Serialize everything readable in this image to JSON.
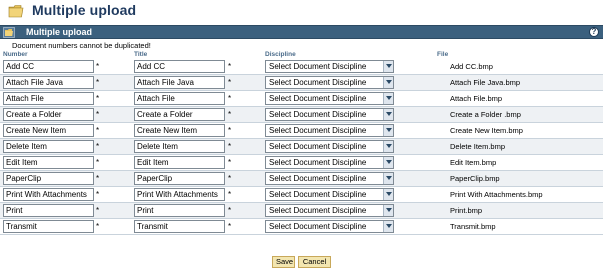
{
  "header": {
    "title": "Multiple upload"
  },
  "panel": {
    "title": "Multiple upload",
    "help_symbol": "?"
  },
  "notice": "Document numbers cannot be duplicated!",
  "columns": {
    "number": "Number",
    "title": "Title",
    "discipline": "Discipline",
    "file": "File"
  },
  "rows": [
    {
      "number": "Add CC",
      "title": "Add CC",
      "discipline": "Select Document Discipline",
      "file": "Add CC.bmp"
    },
    {
      "number": "Attach File Java",
      "title": "Attach File Java",
      "discipline": "Select Document Discipline",
      "file": "Attach File Java.bmp"
    },
    {
      "number": "Attach File",
      "title": "Attach File",
      "discipline": "Select Document Discipline",
      "file": "Attach File.bmp"
    },
    {
      "number": "Create a Folder",
      "title": "Create a Folder",
      "discipline": "Select Document Discipline",
      "file": "Create a Folder .bmp"
    },
    {
      "number": "Create New Item",
      "title": "Create New Item",
      "discipline": "Select Document Discipline",
      "file": "Create New Item.bmp"
    },
    {
      "number": "Delete Item",
      "title": "Delete Item",
      "discipline": "Select Document Discipline",
      "file": "Delete Item.bmp"
    },
    {
      "number": "Edit Item",
      "title": "Edit Item",
      "discipline": "Select Document Discipline",
      "file": "Edit Item.bmp"
    },
    {
      "number": "PaperClip",
      "title": "PaperClip",
      "discipline": "Select Document Discipline",
      "file": "PaperClip.bmp"
    },
    {
      "number": "Print With Attachments",
      "title": "Print With Attachments",
      "discipline": "Select Document Discipline",
      "file": "Print With Attachments.bmp"
    },
    {
      "number": "Print",
      "title": "Print",
      "discipline": "Select Document Discipline",
      "file": "Print.bmp"
    },
    {
      "number": "Transmit",
      "title": "Transmit",
      "discipline": "Select Document Discipline",
      "file": "Transmit.bmp"
    }
  ],
  "required_marker": "*",
  "actions": {
    "save": "Save",
    "cancel": "Cancel"
  },
  "icons": {
    "header": "folder-icon",
    "panel": "folder-small-icon",
    "help": "help-icon",
    "dropdown": "chevron-down-icon"
  },
  "colors": {
    "panel_bar": "#3b607e",
    "title_text": "#1f3a5f",
    "column_header": "#4a6b8a",
    "button_bg": "#f3e6b0",
    "row_alt": "#eef1f4"
  }
}
